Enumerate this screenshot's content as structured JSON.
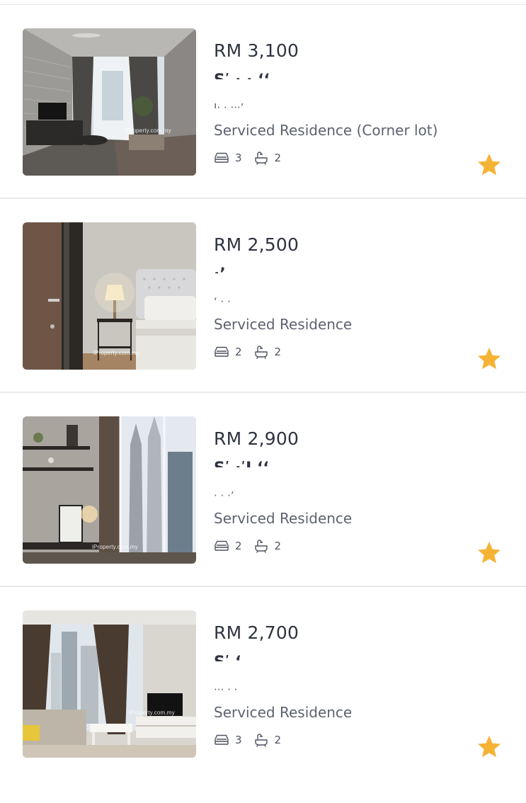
{
  "colors": {
    "text_primary": "#2f3340",
    "text_secondary": "#5d6270",
    "divider": "#e9eaed",
    "star": "#f5b335"
  },
  "icons": {
    "bed": "bed-icon",
    "bath": "bathtub-icon",
    "favourite": "star-icon"
  },
  "listings": [
    {
      "price": "RM 3,100",
      "name_partial": "Sʹ   ·                             · ‘‘",
      "address_partial": "I· ·                          ···’",
      "property_type": "Serviced Residence (Corner lot)",
      "bedrooms": "3",
      "bathrooms": "2",
      "watermark": "iProperty.com.my",
      "favourited": true
    },
    {
      "price": "RM 2,500",
      "name_partial": "·ʼ",
      "address_partial": "‘ ·                              ·",
      "property_type": "Serviced Residence",
      "bedrooms": "2",
      "bathrooms": "2",
      "watermark": "iProperty.com.my",
      "favourited": true
    },
    {
      "price": "RM 2,900",
      "name_partial": "Sʹ                               ·ʹI ‘‘",
      "address_partial": "·                           ·  ·’",
      "property_type": "Serviced Residence",
      "bedrooms": "2",
      "bathrooms": "2",
      "watermark": "iProperty.com.my",
      "favourited": true
    },
    {
      "price": "RM 2,700",
      "name_partial": "Sʹ                                 ‘",
      "address_partial": "··· ·                          ·",
      "property_type": "Serviced Residence",
      "bedrooms": "3",
      "bathrooms": "2",
      "watermark": "iProperty.com.my",
      "favourited": true
    }
  ]
}
